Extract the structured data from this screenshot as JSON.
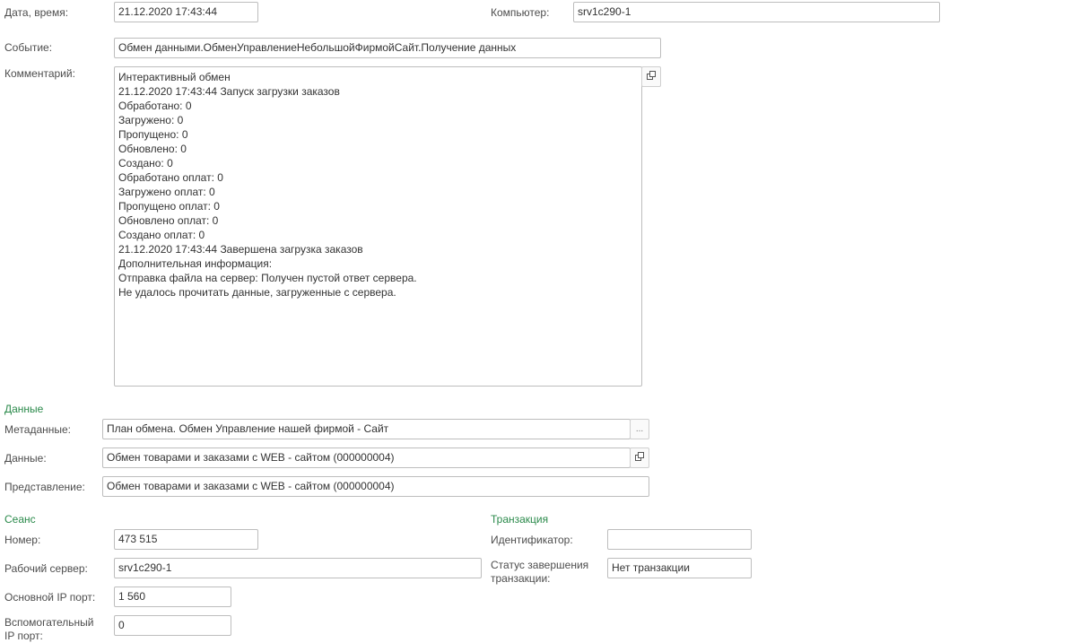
{
  "top": {
    "datetime_label": "Дата, время:",
    "datetime_value": "21.12.2020 17:43:44",
    "computer_label": "Компьютер:",
    "computer_value": "srv1c290-1",
    "event_label": "Событие:",
    "event_value": "Обмен данными.ОбменУправлениеНебольшойФирмойСайт.Получение данных",
    "comment_label": "Комментарий:",
    "comment_value": "Интерактивный обмен\n21.12.2020 17:43:44 Запуск загрузки заказов\nОбработано: 0\nЗагружено: 0\nПропущено: 0\nОбновлено: 0\nСоздано: 0\nОбработано оплат: 0\nЗагружено оплат: 0\nПропущено оплат: 0\nОбновлено оплат: 0\nСоздано оплат: 0\n21.12.2020 17:43:44 Завершена загрузка заказов\nДополнительная информация:\nОтправка файла на сервер: Получен пустой ответ сервера.\nНе удалось прочитать данные, загруженные с сервера."
  },
  "data_section": {
    "title": "Данные",
    "metadata_label": "Метаданные:",
    "metadata_value": "План обмена. Обмен Управление нашей фирмой - Сайт",
    "data_label": "Данные:",
    "data_value": "Обмен товарами и заказами с WEB - сайтом (000000004)",
    "presentation_label": "Представление:",
    "presentation_value": "Обмен товарами и заказами с WEB - сайтом (000000004)"
  },
  "session": {
    "title": "Сеанс",
    "number_label": "Номер:",
    "number_value": "473 515",
    "server_label": "Рабочий сервер:",
    "server_value": "srv1c290-1",
    "main_port_label": "Основной IP порт:",
    "main_port_value": "1 560",
    "aux_port_label_1": "Вспомогательный",
    "aux_port_label_2": "IP порт:",
    "aux_port_value": "0"
  },
  "transaction": {
    "title": "Транзакция",
    "id_label": "Идентификатор:",
    "id_value": "",
    "status_label_1": "Статус завершения",
    "status_label_2": "транзакции:",
    "status_value": "Нет транзакции"
  },
  "icons": {
    "open_icon": "open-window-icon",
    "select_icon": "ellipsis-icon"
  }
}
